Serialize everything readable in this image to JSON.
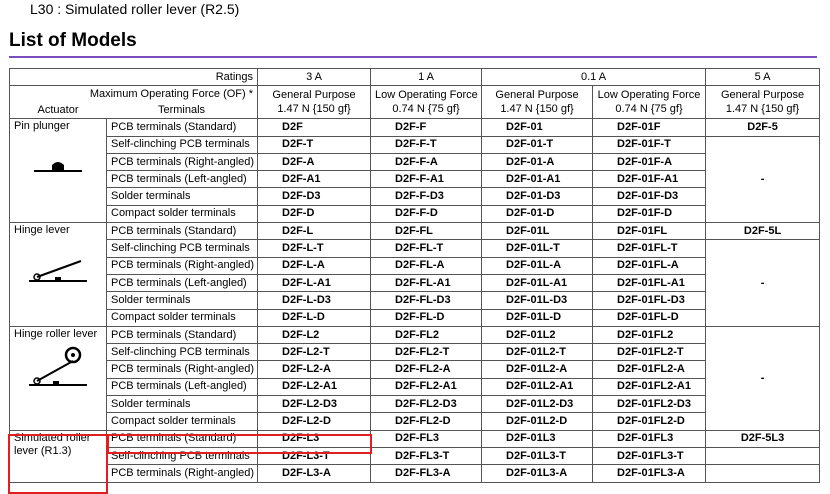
{
  "top_line": "L30  : Simulated roller lever (R2.5)",
  "heading": "List of Models",
  "header": {
    "ratings_label": "Ratings",
    "force_label": "Maximum Operating Force (OF) *",
    "actuator_label": "Actuator",
    "terminals_label": "Terminals",
    "ratings": [
      "3 A",
      "1 A",
      "0.1 A",
      "5 A"
    ],
    "force_cols": [
      {
        "name": "General Purpose",
        "force": "1.47 N {150 gf}"
      },
      {
        "name": "Low Operating Force",
        "force": "0.74 N {75 gf}"
      },
      {
        "name": "General Purpose",
        "force": "1.47 N {150 gf}"
      },
      {
        "name": "Low Operating Force",
        "force": "0.74 N {75 gf}"
      },
      {
        "name": "General Purpose",
        "force": "1.47 N {150 gf}"
      }
    ]
  },
  "terminals": [
    "PCB terminals (Standard)",
    "Self-clinching PCB terminals",
    "PCB terminals (Right-angled)",
    "PCB terminals (Left-angled)",
    "Solder terminals",
    "Compact solder terminals"
  ],
  "groups": [
    {
      "actuator": "Pin plunger",
      "icon": "pin-plunger-icon",
      "rows": [
        [
          "D2F",
          "D2F-F",
          "D2F-01",
          "D2F-01F"
        ],
        [
          "D2F-T",
          "D2F-F-T",
          "D2F-01-T",
          "D2F-01F-T"
        ],
        [
          "D2F-A",
          "D2F-F-A",
          "D2F-01-A",
          "D2F-01F-A"
        ],
        [
          "D2F-A1",
          "D2F-F-A1",
          "D2F-01-A1",
          "D2F-01F-A1"
        ],
        [
          "D2F-D3",
          "D2F-F-D3",
          "D2F-01-D3",
          "D2F-01F-D3"
        ],
        [
          "D2F-D",
          "D2F-F-D",
          "D2F-01-D",
          "D2F-01F-D"
        ]
      ],
      "five_a_first": "D2F-5",
      "five_a_rest": "-"
    },
    {
      "actuator": "Hinge lever",
      "icon": "hinge-lever-icon",
      "rows": [
        [
          "D2F-L",
          "D2F-FL",
          "D2F-01L",
          "D2F-01FL"
        ],
        [
          "D2F-L-T",
          "D2F-FL-T",
          "D2F-01L-T",
          "D2F-01FL-T"
        ],
        [
          "D2F-L-A",
          "D2F-FL-A",
          "D2F-01L-A",
          "D2F-01FL-A"
        ],
        [
          "D2F-L-A1",
          "D2F-FL-A1",
          "D2F-01L-A1",
          "D2F-01FL-A1"
        ],
        [
          "D2F-L-D3",
          "D2F-FL-D3",
          "D2F-01L-D3",
          "D2F-01FL-D3"
        ],
        [
          "D2F-L-D",
          "D2F-FL-D",
          "D2F-01L-D",
          "D2F-01FL-D"
        ]
      ],
      "five_a_first": "D2F-5L",
      "five_a_rest": "-"
    },
    {
      "actuator": "Hinge roller lever",
      "icon": "hinge-roller-lever-icon",
      "rows": [
        [
          "D2F-L2",
          "D2F-FL2",
          "D2F-01L2",
          "D2F-01FL2"
        ],
        [
          "D2F-L2-T",
          "D2F-FL2-T",
          "D2F-01L2-T",
          "D2F-01FL2-T"
        ],
        [
          "D2F-L2-A",
          "D2F-FL2-A",
          "D2F-01L2-A",
          "D2F-01FL2-A"
        ],
        [
          "D2F-L2-A1",
          "D2F-FL2-A1",
          "D2F-01L2-A1",
          "D2F-01FL2-A1"
        ],
        [
          "D2F-L2-D3",
          "D2F-FL2-D3",
          "D2F-01L2-D3",
          "D2F-01FL2-D3"
        ],
        [
          "D2F-L2-D",
          "D2F-FL2-D",
          "D2F-01L2-D",
          "D2F-01FL2-D"
        ]
      ],
      "five_a_rest": "-"
    },
    {
      "actuator": "Simulated roller lever (R1.3)",
      "icon": "",
      "rows": [
        [
          "D2F-L3",
          "D2F-FL3",
          "D2F-01L3",
          "D2F-01FL3"
        ],
        [
          "D2F-L3-T",
          "D2F-FL3-T",
          "D2F-01L3-T",
          "D2F-01FL3-T"
        ],
        [
          "D2F-L3-A",
          "D2F-FL3-A",
          "D2F-01L3-A",
          "D2F-01FL3-A"
        ]
      ],
      "five_a_first": "D2F-5L3"
    }
  ],
  "colors": {
    "rule": "#7b4ec0",
    "highlight": "#e02020",
    "border": "#555555"
  }
}
